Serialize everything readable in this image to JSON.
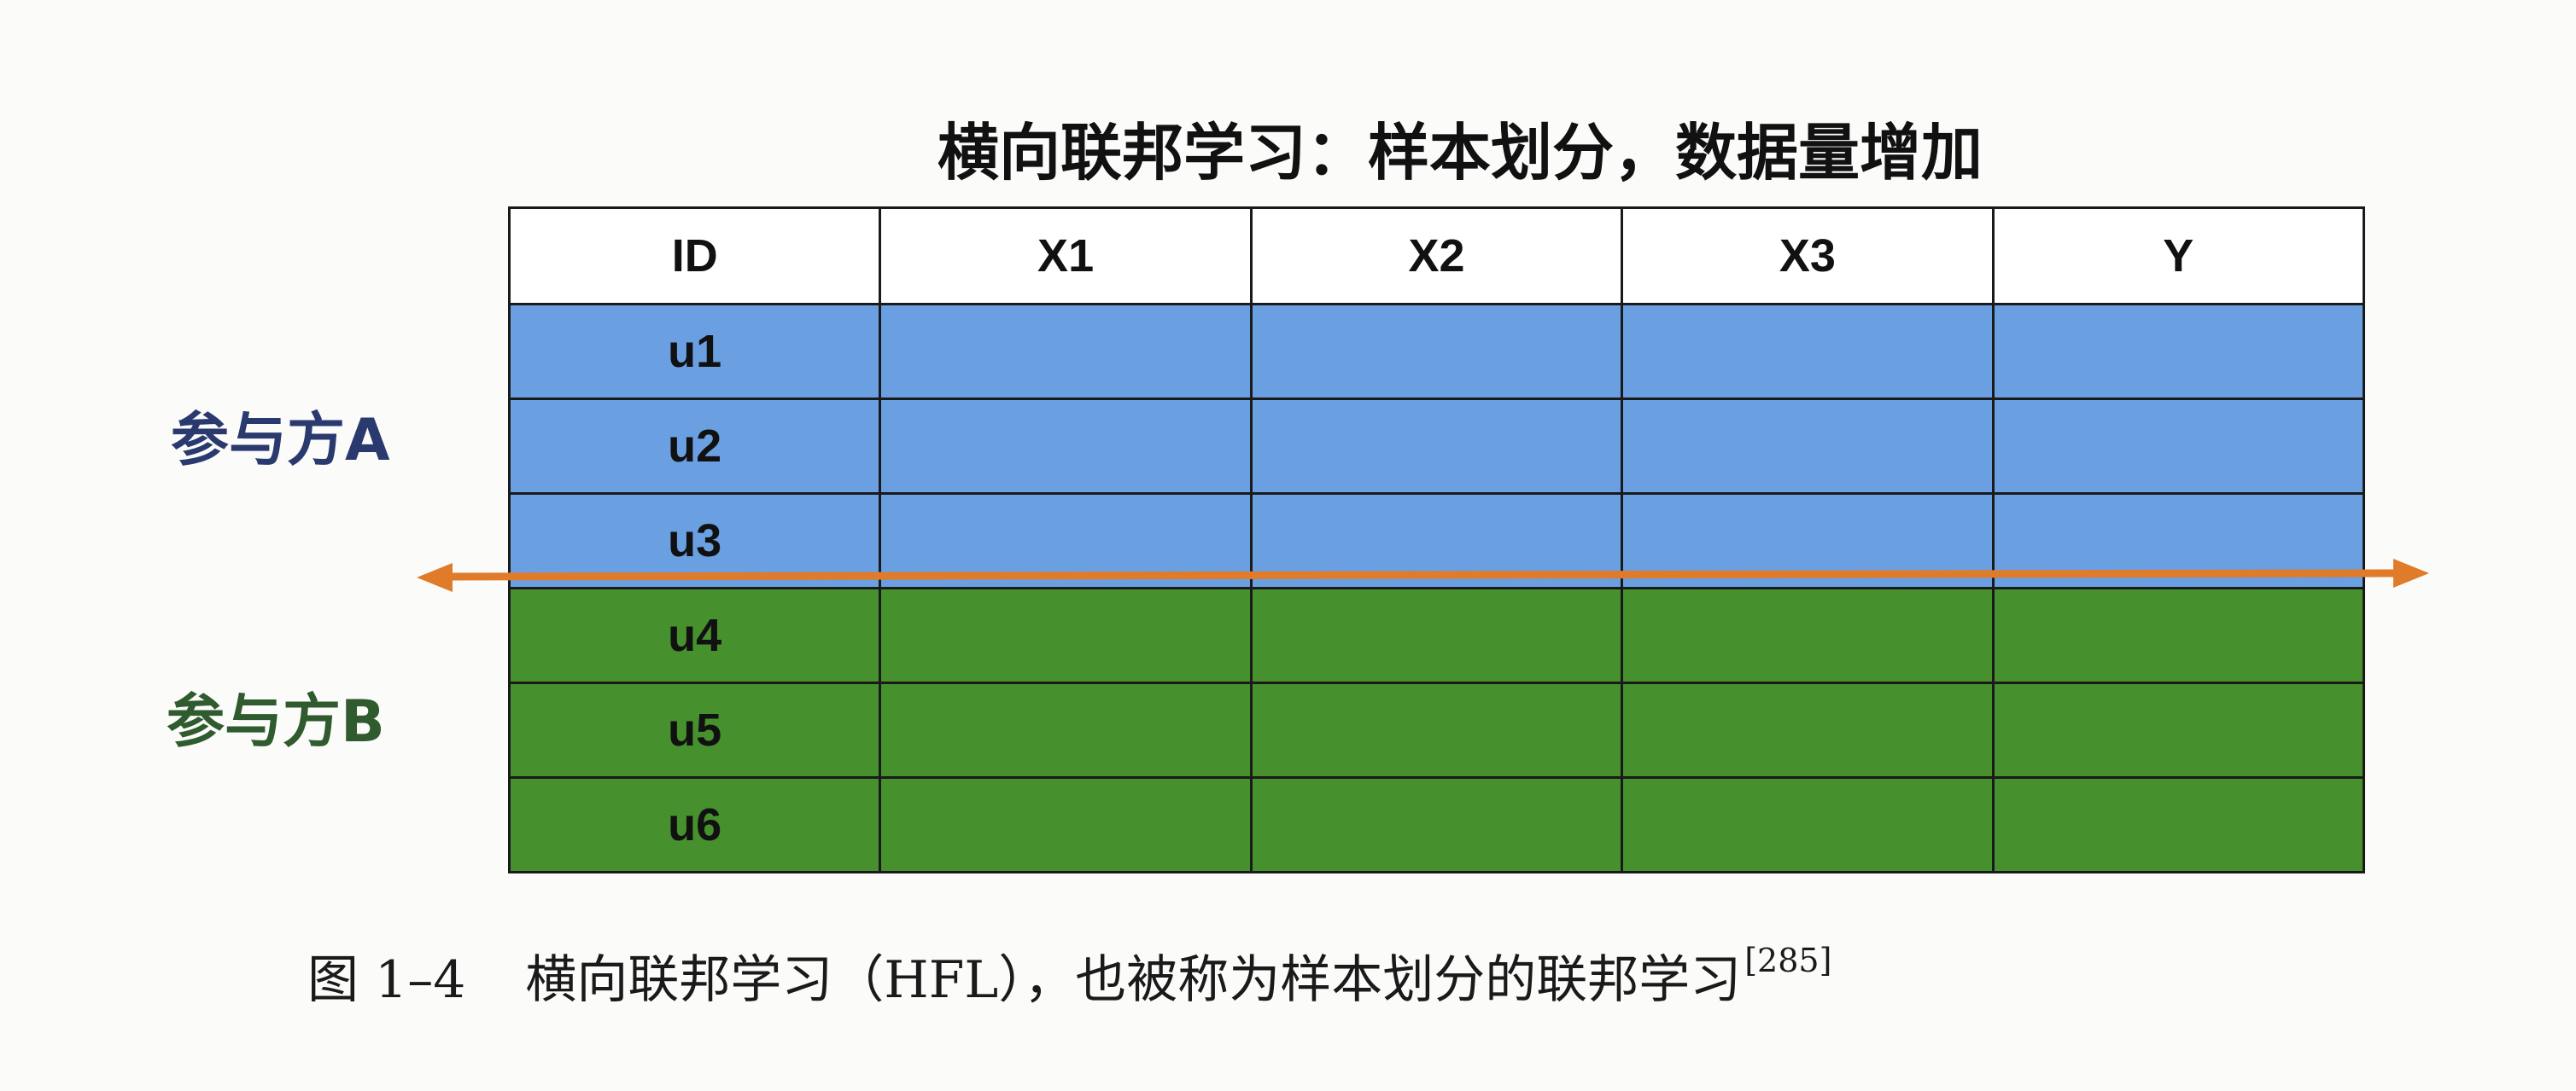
{
  "title": "横向联邦学习：样本划分，数据量增加",
  "parties": {
    "a_label": "参与方A",
    "b_label": "参与方B"
  },
  "table": {
    "headers": [
      "ID",
      "X1",
      "X2",
      "X3",
      "Y"
    ],
    "rows": [
      {
        "id": "u1",
        "party": "A"
      },
      {
        "id": "u2",
        "party": "A"
      },
      {
        "id": "u3",
        "party": "A"
      },
      {
        "id": "u4",
        "party": "B"
      },
      {
        "id": "u5",
        "party": "B"
      },
      {
        "id": "u6",
        "party": "B"
      }
    ]
  },
  "colors": {
    "party_a_fill": "#6a9fe2",
    "party_b_fill": "#46902d",
    "party_a_text": "#2a3a6e",
    "party_b_text": "#2f5b2e",
    "divider_arrow": "#e07b2a"
  },
  "caption": {
    "figure_number": "图 1–4",
    "text": "横向联邦学习（HFL），也被称为样本划分的联邦学习",
    "ref": "[285]"
  }
}
